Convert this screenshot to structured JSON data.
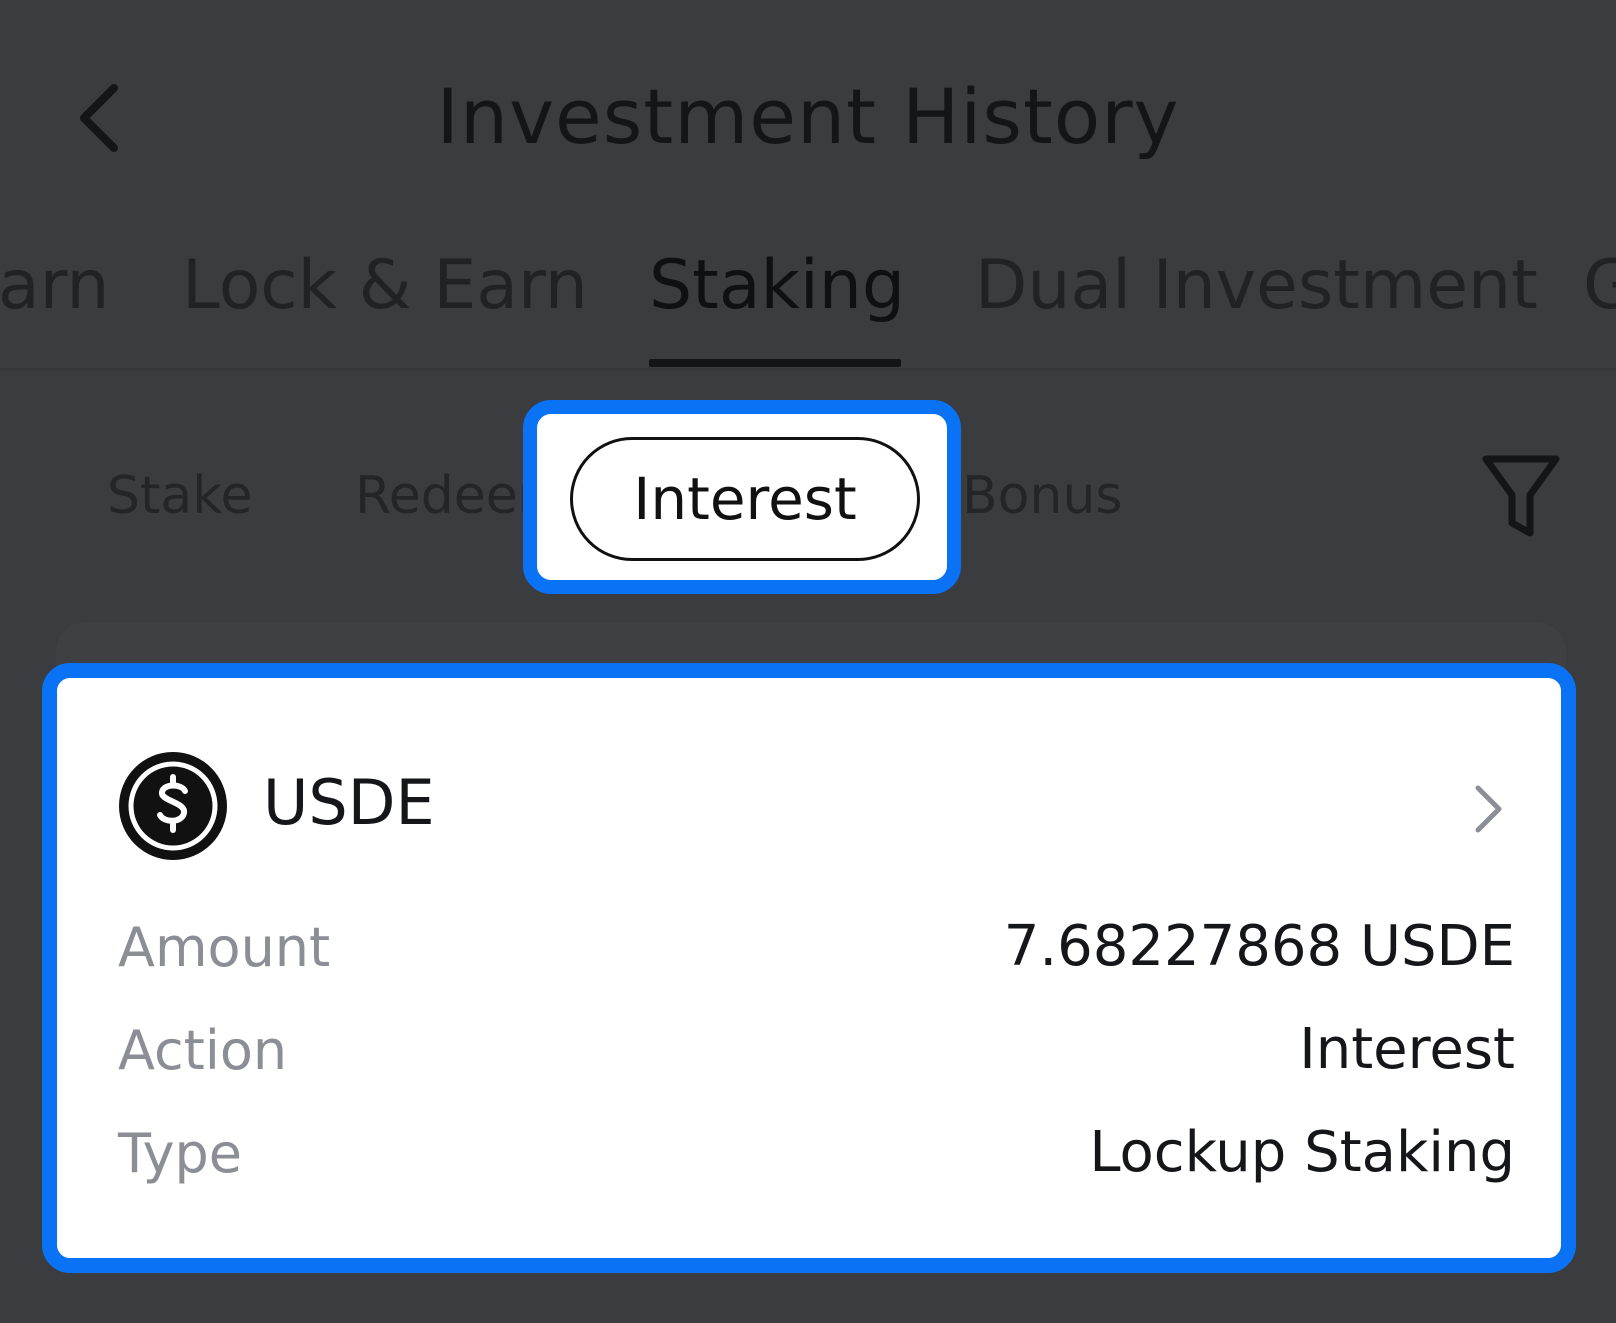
{
  "header": {
    "title": "Investment History",
    "back_icon": "chevron-left-icon"
  },
  "tabs": [
    {
      "label": "arn"
    },
    {
      "label": "Lock & Earn"
    },
    {
      "label": "Staking",
      "active": true
    },
    {
      "label": "Dual Investment"
    },
    {
      "label": "G"
    }
  ],
  "filters": {
    "chips": [
      {
        "label": "Stake"
      },
      {
        "label": "Redeem"
      },
      {
        "label": "Interest",
        "selected": true
      },
      {
        "label": "Bonus"
      }
    ],
    "filter_icon": "funnel-icon"
  },
  "record": {
    "coin": "USDE",
    "coin_icon": "dollar-coin-icon",
    "rows": [
      {
        "label": "Amount",
        "value": "7.68227868 USDE"
      },
      {
        "label": "Action",
        "value": "Interest"
      },
      {
        "label": "Type",
        "value": "Lockup Staking"
      }
    ]
  },
  "colors": {
    "highlight": "#0a72f5",
    "background": "#3a3c40"
  }
}
